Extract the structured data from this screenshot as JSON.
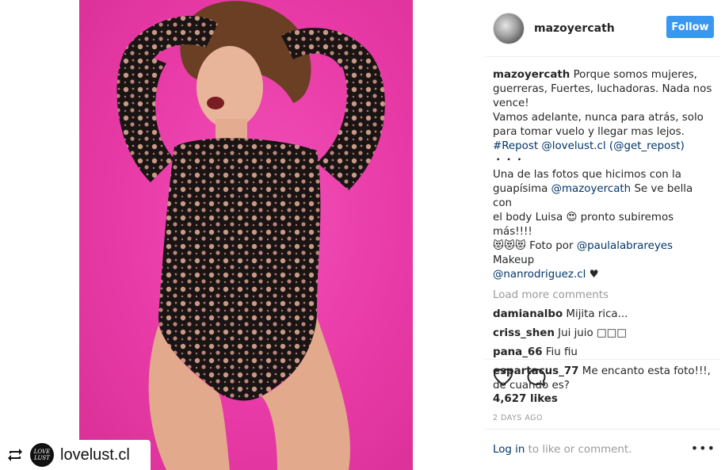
{
  "header": {
    "username": "mazoyercath",
    "follow_label": "Follow"
  },
  "repost": {
    "logo_text": "LOVE LUST",
    "name": "lovelust.cl"
  },
  "caption": {
    "username": "mazoyercath",
    "line1": "Porque somos mujeres,",
    "line2": "guerreras, Fuertes, luchadoras. Nada nos",
    "line3": "vence!",
    "line4": "Vamos adelante, nunca para atrás, solo",
    "line5": "para tomar vuelo y llegar mas lejos.",
    "hashtag": "#Repost",
    "mention1": "@lovelust.cl",
    "paren_open": "(",
    "mention2": "@get_repost",
    "paren_close": ")",
    "dots": "・・・",
    "line6": "Una de las fotos que hicimos con la",
    "line7a": "guapísima",
    "mention3": "@mazoyercath",
    "line7b": "Se ve bella con",
    "line8": "el body Luisa 😍 pronto subiremos más!!!!",
    "line9a": "😻😻😻 Foto por",
    "mention4": "@paulalabrareyes",
    "line9b": "Makeup",
    "mention5": "@nanrodriguez.cl",
    "line10": "♥"
  },
  "load_more": "Load more comments",
  "comments": [
    {
      "user": "damianalbo",
      "text": "Mijita rica..."
    },
    {
      "user": "criss_shen",
      "text": "Jui juio □□□"
    },
    {
      "user": "pana_66",
      "text": "Fiu fiu"
    },
    {
      "user": "espartacus_77",
      "text": "Me encanto esta foto!!!, de cuando es?"
    }
  ],
  "likes": "4,627 likes",
  "time": "2 DAYS AGO",
  "footer": {
    "login_label": "Log in",
    "rest": "to like or comment.",
    "more": "•••"
  },
  "icons": {
    "heart": "heart-icon",
    "comment": "comment-icon",
    "repost": "repost-icon"
  },
  "colors": {
    "background_pink": "#e83aa6",
    "follow_blue": "#3897f0",
    "link": "#003569",
    "muted": "#999999"
  }
}
